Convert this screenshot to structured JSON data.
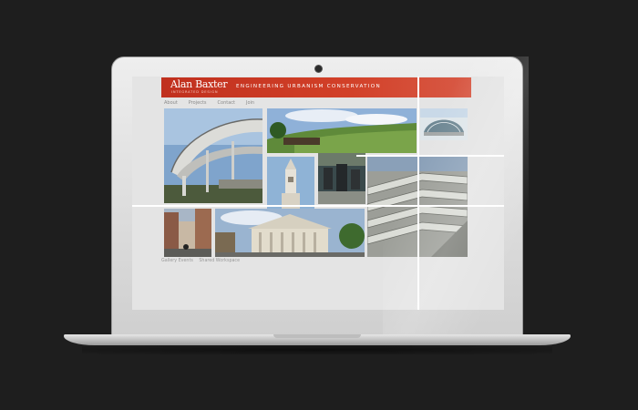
{
  "site": {
    "logo_main": "Alan Baxter",
    "logo_sub": "INTEGRATED DESIGN",
    "tagline": "ENGINEERING  URBANISM  CONSERVATION",
    "accent_color": "#c8351f"
  },
  "nav": {
    "items": [
      {
        "label": "About"
      },
      {
        "label": "Projects"
      },
      {
        "label": "Contact"
      },
      {
        "label": "Join"
      }
    ]
  },
  "footer": {
    "links": [
      {
        "label": "Gallery Events"
      },
      {
        "label": "Shared Workspace"
      }
    ]
  },
  "gallery": {
    "photos": [
      {
        "subject": "footbridge-photo"
      },
      {
        "subject": "landscape-photo"
      },
      {
        "subject": "glass-building-photo"
      },
      {
        "subject": "church-tower-photo"
      },
      {
        "subject": "water-feature-photo"
      },
      {
        "subject": "roof-detail-photo"
      },
      {
        "subject": "street-photo"
      },
      {
        "subject": "church-facade-photo"
      }
    ]
  }
}
